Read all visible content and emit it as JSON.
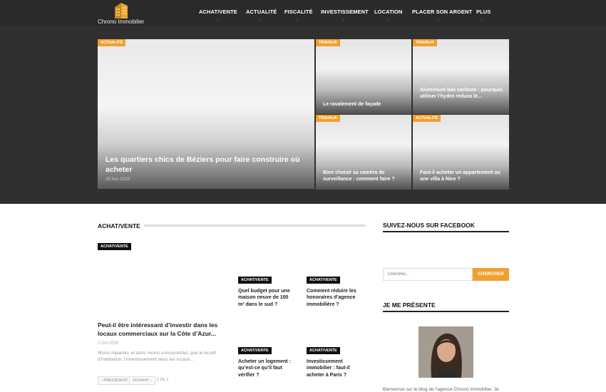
{
  "header": {
    "logo_text": "Chrono Immobilier",
    "nav": [
      {
        "label": "ACHAT/VENTE",
        "name": "nav-achat-vente"
      },
      {
        "label": "ACTUALITÉ",
        "name": "nav-actualite"
      },
      {
        "label": "FISCALITÉ",
        "name": "nav-fiscalite"
      },
      {
        "label": "INVESTISSEMENT",
        "name": "nav-investissement"
      },
      {
        "label": "LOCATION",
        "name": "nav-location"
      },
      {
        "label": "PLACER SON ARGENT",
        "name": "nav-placer-son-argent"
      },
      {
        "label": "PLUS",
        "name": "nav-plus"
      }
    ],
    "caret": "⌄"
  },
  "hero": {
    "featured": {
      "tag": "ACTUALITÉ",
      "title": "Les quartiers chics de Béziers pour faire construire où acheter",
      "date": "25 Nov 2020"
    },
    "tiles": [
      {
        "tag": "TRAVAUX",
        "title": "Le ravalement de façade"
      },
      {
        "tag": "TRAVAUX",
        "title": "Aluminium bas carbone : pourquoi utiliser l’hydro reduxa le..."
      },
      {
        "tag": "TRAVAUX",
        "title": "Bien choisir sa caméra de surveillance : comment faire ?"
      },
      {
        "tag": "ACTUALITÉ",
        "title": "Faut-il acheter un appartement ou une villa à Nice ?"
      }
    ]
  },
  "section": {
    "heading": "ACHAT/VENTE",
    "main_article": {
      "tag": "ACHAT/VENTE",
      "title": "Peut-il être intéressant d’investir dans les locaux commerciaux sur la Côte d’Azur...",
      "date": "2 Oct 2020",
      "excerpt": "Moins répandu, et donc moins concurrentiel, que le locatif d’habitation, l’investissement dans les locaux..."
    },
    "articles": [
      {
        "tag": "ACHAT/VENTE",
        "title": "Quel budget pour une maison neuve de 100 m² dans le sud ?"
      },
      {
        "tag": "ACHAT/VENTE",
        "title": "Comment réduire les honoraires d’agence immobilière ?"
      },
      {
        "tag": "ACHAT/VENTE",
        "title": "Acheter un logement : qu’est-ce qu’il faut vérifier ?"
      },
      {
        "tag": "ACHAT/VENTE",
        "title": "Investissement immobilier : faut-il acheter à Paris ?"
      }
    ],
    "pager": {
      "prev": "‹ PRÉCÉDENT",
      "next": "SUIVANT ›",
      "info": "1 De 2"
    }
  },
  "sidebar": {
    "facebook_heading": "SUIVEZ-NOUS SUR FACEBOOK",
    "search": {
      "placeholder": "Chercher...",
      "button": "CHERCHER"
    },
    "about_heading": "JE ME PRÉSENTE",
    "about_text": "Bienvenue sur le blog de l’agence Chrono Immobilier. Je"
  },
  "colors": {
    "accent": "#f0a030",
    "dark": "#2a2a2a",
    "hero_bg": "#303030"
  }
}
